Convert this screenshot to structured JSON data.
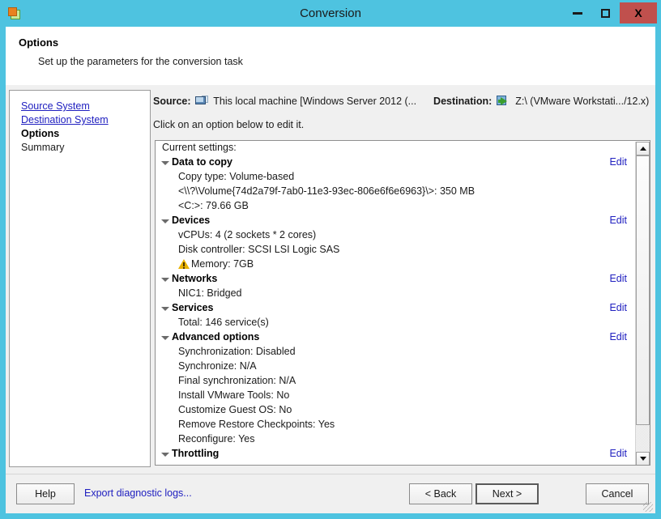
{
  "window": {
    "title": "Conversion",
    "icon": "vmware-converter-icon",
    "buttons": {
      "minimize": "minimize-icon",
      "maximize": "maximize-icon",
      "close": "X"
    },
    "close_color": "#c0504d",
    "titlebar_color": "#4EC3E0"
  },
  "header": {
    "title": "Options",
    "subtitle": "Set up the parameters for the conversion task"
  },
  "sidebar": {
    "items": [
      {
        "label": "Source System",
        "state": "link"
      },
      {
        "label": "Destination System",
        "state": "link"
      },
      {
        "label": "Options",
        "state": "current"
      },
      {
        "label": "Summary",
        "state": "normal"
      }
    ]
  },
  "main": {
    "source_label": "Source:",
    "source_value": "This local machine [Windows Server 2012 (...",
    "source_icon": "monitor-icon",
    "destination_label": "Destination:",
    "destination_value": "Z:\\ (VMware Workstati.../12.x)",
    "destination_icon": "export-arrow-icon",
    "click_hint": "Click on an option below to edit it.",
    "current_settings_caption": "Current settings:",
    "edit_label": "Edit",
    "link_color": "#2020c0",
    "rows": [
      {
        "type": "group",
        "label": "Data to copy",
        "edit": true
      },
      {
        "type": "item",
        "label": "Copy type: Volume-based"
      },
      {
        "type": "item",
        "label": "<\\\\?\\Volume{74d2a79f-7ab0-11e3-93ec-806e6f6e6963}\\>: 350 MB"
      },
      {
        "type": "item",
        "label": "<C:>: 79.66 GB"
      },
      {
        "type": "group",
        "label": "Devices",
        "edit": true
      },
      {
        "type": "item",
        "label": "vCPUs: 4 (2 sockets * 2 cores)"
      },
      {
        "type": "item",
        "label": "Disk controller: SCSI LSI Logic SAS"
      },
      {
        "type": "item",
        "label": "Memory: 7GB",
        "warning": true
      },
      {
        "type": "group",
        "label": "Networks",
        "edit": true
      },
      {
        "type": "item",
        "label": "NIC1: Bridged"
      },
      {
        "type": "group",
        "label": "Services",
        "edit": true
      },
      {
        "type": "item",
        "label": "Total: 146 service(s)"
      },
      {
        "type": "group",
        "label": "Advanced options",
        "edit": true
      },
      {
        "type": "item",
        "label": "Synchronization: Disabled"
      },
      {
        "type": "item",
        "label": "Synchronize: N/A"
      },
      {
        "type": "item",
        "label": "Final synchronization: N/A"
      },
      {
        "type": "item",
        "label": "Install VMware Tools: No"
      },
      {
        "type": "item",
        "label": "Customize Guest OS: No"
      },
      {
        "type": "item",
        "label": "Remove Restore Checkpoints: Yes"
      },
      {
        "type": "item",
        "label": "Reconfigure: Yes"
      },
      {
        "type": "group",
        "label": "Throttling",
        "edit": true
      }
    ]
  },
  "footer": {
    "help": "Help",
    "export_logs": "Export diagnostic logs...",
    "back": "< Back",
    "next": "Next >",
    "cancel": "Cancel"
  }
}
